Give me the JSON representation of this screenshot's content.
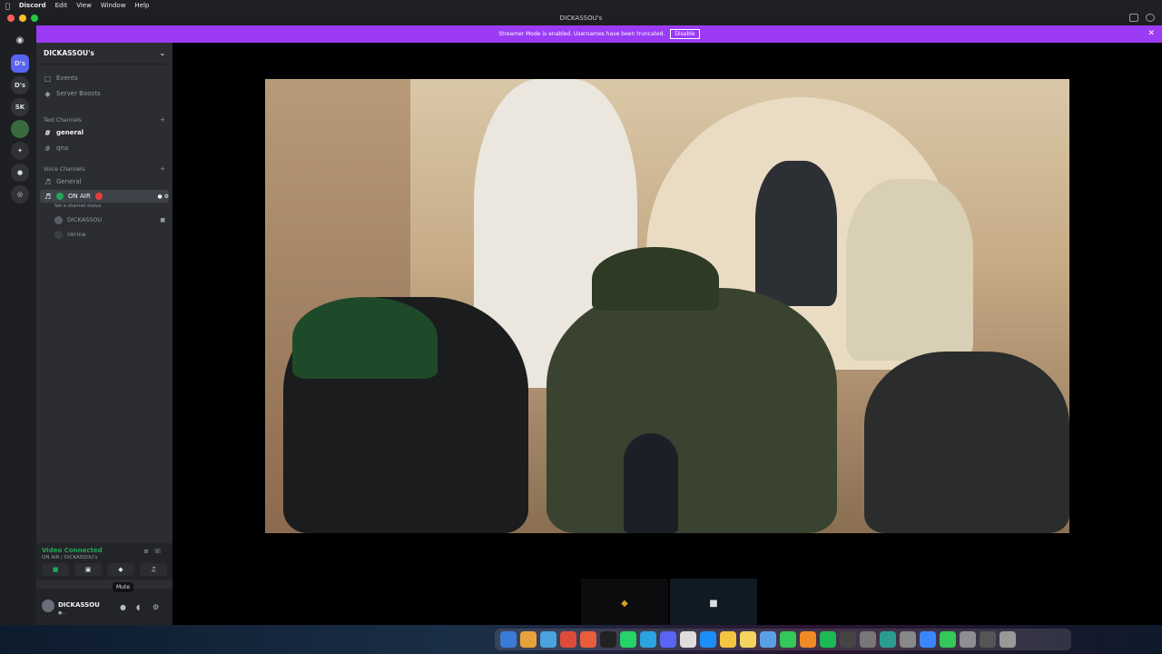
{
  "menubar": {
    "app": "Discord",
    "items": [
      "Edit",
      "View",
      "Window",
      "Help"
    ]
  },
  "titlebar": {
    "title": "DICKASSOU's"
  },
  "guilds": [
    {
      "label": "D's"
    },
    {
      "label": "D's"
    },
    {
      "label": "SK"
    }
  ],
  "banner": {
    "text": "Streamer Mode is enabled. Usernames have been truncated.",
    "button": "Disable"
  },
  "server": {
    "name": "DICKASSOU's",
    "events": "Events",
    "boosts": "Server Boosts",
    "text_category": "Text Channels",
    "text_channels": [
      "general",
      "qna"
    ],
    "voice_category": "Voice Channels",
    "voice_channels": [
      "General",
      "ON AIR"
    ],
    "channel_status": "Set a channel status",
    "members": [
      "DICKASSOU",
      "nkrine"
    ]
  },
  "voice": {
    "status": "Video Connected",
    "channel": "ON AIR / DICKASSOU's"
  },
  "user": {
    "name": "DICKASSOU",
    "tag": "●...",
    "tooltip": "Mute"
  },
  "colors": {
    "accent": "#9b3bf5",
    "online": "#23a559",
    "live": "#e33e3e"
  }
}
